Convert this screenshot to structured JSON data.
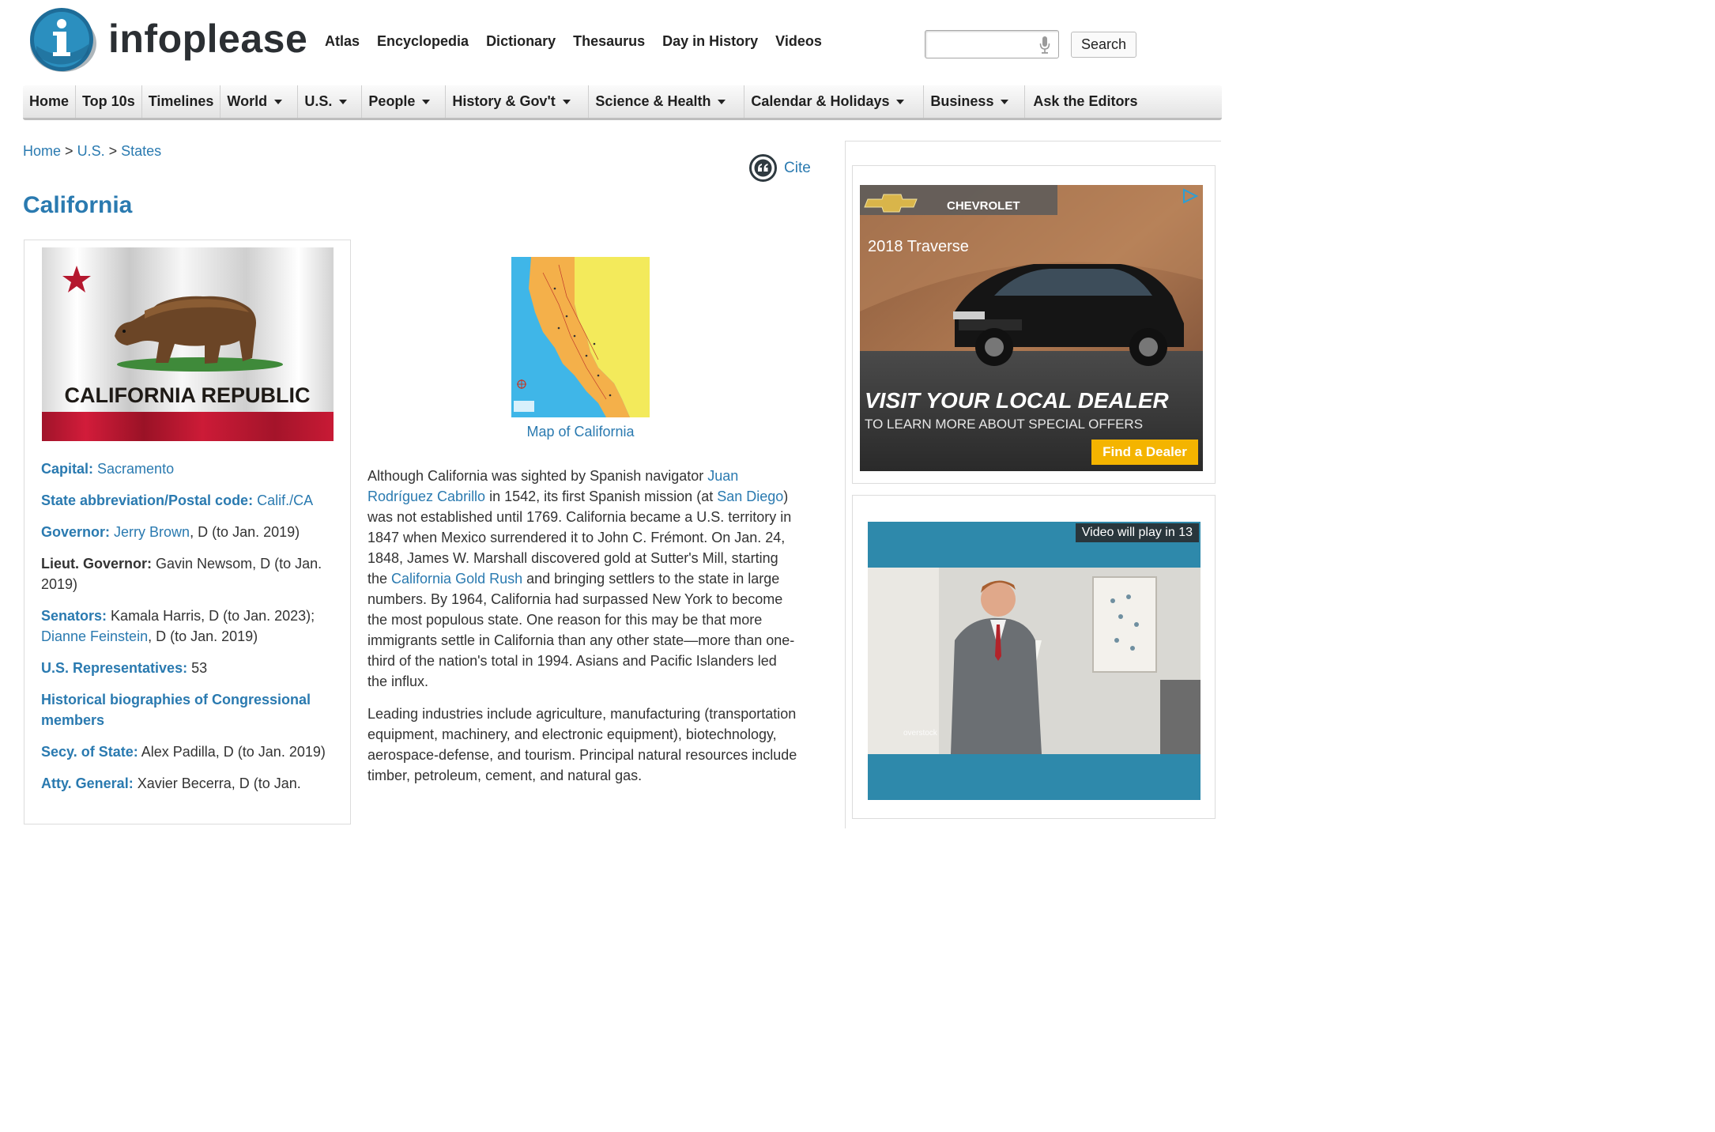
{
  "header": {
    "logo_text": "infoplease",
    "logo_letter": "i",
    "top_links": [
      "Atlas",
      "Encyclopedia",
      "Dictionary",
      "Thesaurus",
      "Day in History",
      "Videos"
    ],
    "search_value": "",
    "search_button": "Search"
  },
  "mainnav": [
    {
      "label": "Home",
      "dropdown": false
    },
    {
      "label": "Top 10s",
      "dropdown": false
    },
    {
      "label": "Timelines",
      "dropdown": false
    },
    {
      "label": "World",
      "dropdown": true
    },
    {
      "label": "U.S.",
      "dropdown": true
    },
    {
      "label": "People",
      "dropdown": true
    },
    {
      "label": "History & Gov't",
      "dropdown": true
    },
    {
      "label": "Science & Health",
      "dropdown": true
    },
    {
      "label": "Calendar & Holidays",
      "dropdown": true
    },
    {
      "label": "Business",
      "dropdown": true
    },
    {
      "label": "Ask the Editors",
      "dropdown": false
    }
  ],
  "breadcrumb": {
    "home": "Home",
    "sep": ">",
    "us": "U.S.",
    "states": "States"
  },
  "cite": "Cite",
  "title": "California",
  "flag": {
    "text": "CALIFORNIA  REPUBLIC"
  },
  "facts": {
    "capital_label": "Capital:",
    "capital_value": "Sacramento",
    "abbr_label": "State abbreviation/Postal code:",
    "abbr_value": "Calif./CA",
    "gov_label": "Governor:",
    "gov_link": "Jerry Brown",
    "gov_rest": ", D (to Jan. 2019)",
    "lgov_label": "Lieut. Governor:",
    "lgov_value": "Gavin Newsom, D (to Jan. 2019)",
    "sen_label": "Senators:",
    "sen_value1": "Kamala Harris, D (to Jan. 2023);",
    "sen_link": "Dianne Feinstein",
    "sen_rest": ", D (to Jan. 2019)",
    "rep_label": "U.S. Representatives:",
    "rep_value": "53",
    "hist_link": "Historical biographies of Congressional members",
    "secy_label": "Secy. of State:",
    "secy_value": "Alex Padilla, D (to Jan. 2019)",
    "atty_label": "Atty. General:",
    "atty_value": "Xavier Becerra, D (to Jan."
  },
  "map": {
    "caption": "Map of California"
  },
  "article": {
    "p1_a": "Although California was sighted by Spanish navigator ",
    "p1_link1": "Juan Rodríguez Cabrillo",
    "p1_b": " in 1542, its first Spanish mission (at ",
    "p1_link2": "San Diego",
    "p1_c": ") was not established until 1769. California became a U.S. territory in 1847 when Mexico surrendered it to John C. Frémont. On Jan. 24, 1848, James W. Marshall discovered gold at Sutter's Mill, starting the ",
    "p1_link3": "California Gold Rush",
    "p1_d": " and bringing settlers to the state in large numbers. By 1964, California had surpassed New York to become the most populous state. One reason for this may be that more immigrants settle in California than any other state—more than one-third of the nation's total in 1994. Asians and Pacific Islanders led the influx.",
    "p2": "Leading industries include agriculture, manufacturing (transportation equipment, machinery, and electronic equipment), biotechnology, aerospace-defense, and tourism. Principal natural resources include timber, petroleum, cement, and natural gas."
  },
  "ad1": {
    "brand": "CHEVROLET",
    "model": "2018 Traverse",
    "headline": "VISIT YOUR LOCAL DEALER",
    "subhead": "TO LEARN MORE ABOUT SPECIAL OFFERS",
    "cta": "Find a Dealer"
  },
  "ad2": {
    "countdown": "Video will play in 13",
    "watermark": "overstock"
  }
}
